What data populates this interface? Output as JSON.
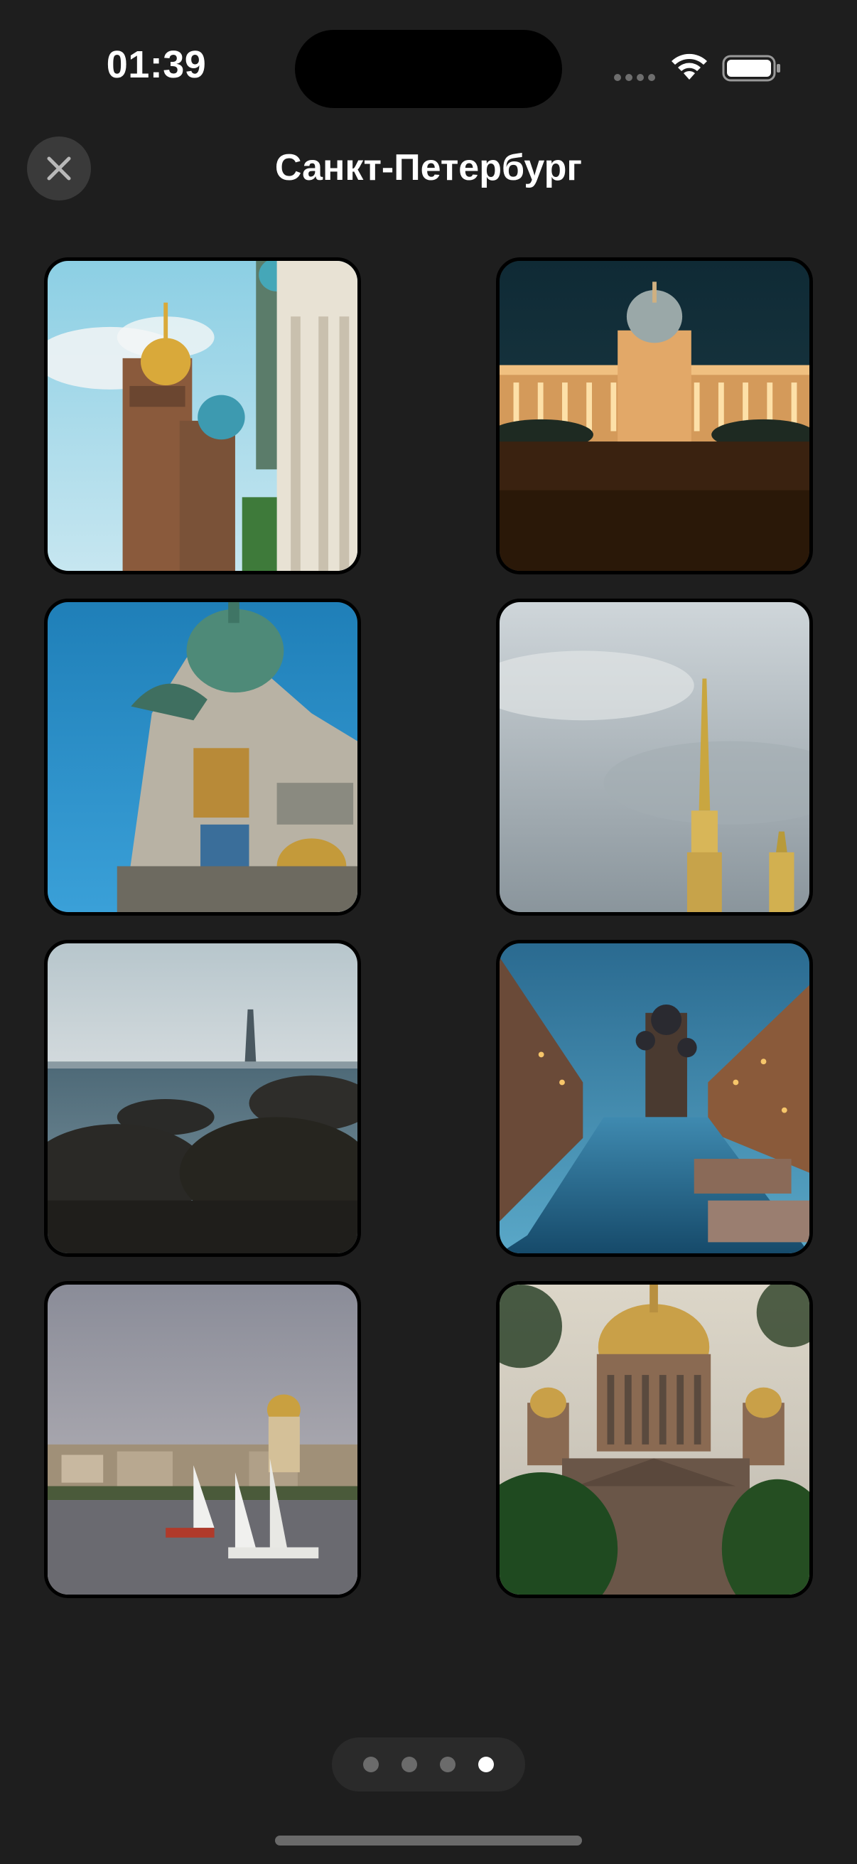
{
  "status_bar": {
    "time": "01:39"
  },
  "header": {
    "title": "Санкт-Петербург",
    "close_icon": "close-icon"
  },
  "photos": [
    {
      "name": "photo-church-savior-on-blood"
    },
    {
      "name": "photo-kazan-cathedral-night"
    },
    {
      "name": "photo-singer-house"
    },
    {
      "name": "photo-peter-paul-spire"
    },
    {
      "name": "photo-lakhta-center-sea"
    },
    {
      "name": "photo-griboedov-canal"
    },
    {
      "name": "photo-neva-sailboats"
    },
    {
      "name": "photo-st-isaacs-cathedral"
    }
  ],
  "pagination": {
    "total_pages": 4,
    "current_page": 4
  },
  "colors": {
    "background": "#1e1e1e",
    "close_button_bg": "#3a3a3a",
    "active_dot": "#ffffff",
    "inactive_dot": "#6b6b6b"
  }
}
